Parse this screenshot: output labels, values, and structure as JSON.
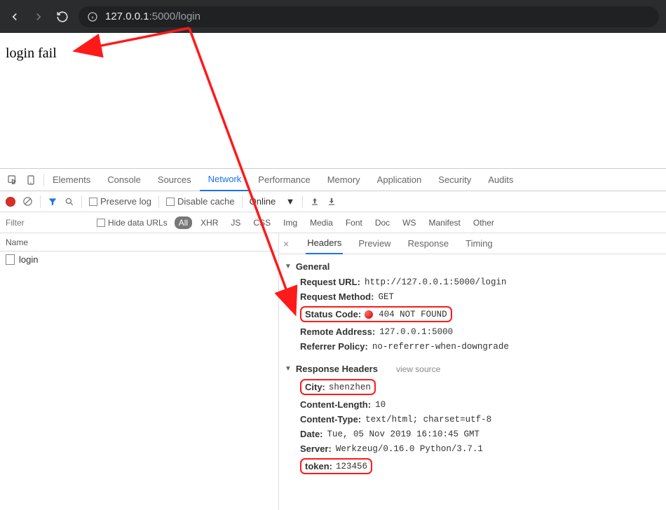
{
  "browser": {
    "url_host": "127.0.0.1",
    "url_port": ":5000",
    "url_path": "/login"
  },
  "page": {
    "body_text": "login fail"
  },
  "devtools": {
    "tabs": [
      "Elements",
      "Console",
      "Sources",
      "Network",
      "Performance",
      "Memory",
      "Application",
      "Security",
      "Audits"
    ],
    "active_tab": "Network"
  },
  "net_toolbar": {
    "preserve_log": "Preserve log",
    "disable_cache": "Disable cache",
    "online": "Online"
  },
  "filter_bar": {
    "filter_placeholder": "Filter",
    "hide_data_urls": "Hide data URLs",
    "types": [
      "All",
      "XHR",
      "JS",
      "CSS",
      "Img",
      "Media",
      "Font",
      "Doc",
      "WS",
      "Manifest",
      "Other"
    ],
    "selected_type": "All"
  },
  "net_list": {
    "header": "Name",
    "items": [
      "login"
    ]
  },
  "details": {
    "tabs": [
      "Headers",
      "Preview",
      "Response",
      "Timing"
    ],
    "active_tab": "Headers",
    "general": {
      "title": "General",
      "request_url_label": "Request URL:",
      "request_url": "http://127.0.0.1:5000/login",
      "request_method_label": "Request Method:",
      "request_method": "GET",
      "status_code_label": "Status Code:",
      "status_code": "404 NOT FOUND",
      "remote_address_label": "Remote Address:",
      "remote_address": "127.0.0.1:5000",
      "referrer_policy_label": "Referrer Policy:",
      "referrer_policy": "no-referrer-when-downgrade"
    },
    "response_headers": {
      "title": "Response Headers",
      "view_source": "view source",
      "city_label": "City:",
      "city": "shenzhen",
      "content_length_label": "Content-Length:",
      "content_length": "10",
      "content_type_label": "Content-Type:",
      "content_type": "text/html; charset=utf-8",
      "date_label": "Date:",
      "date": "Tue, 05 Nov 2019 16:10:45 GMT",
      "server_label": "Server:",
      "server": "Werkzeug/0.16.0 Python/3.7.1",
      "token_label": "token:",
      "token": "123456"
    }
  }
}
